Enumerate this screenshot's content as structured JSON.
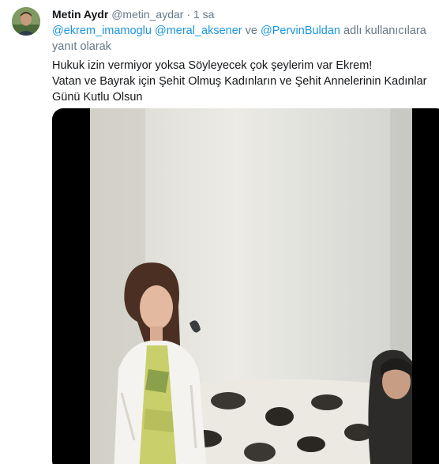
{
  "tweet": {
    "display_name": "Metin Aydr",
    "handle": "@metin_aydar",
    "separator": "·",
    "time": "1 sa",
    "reply": {
      "mentions": [
        "@ekrem_imamoglu",
        "@meral_aksener",
        "@PervinBuldan"
      ],
      "connector": "ve",
      "suffix": "adlı kullanıcılara yanıt olarak"
    },
    "text_lines": [
      "Hukuk izin vermiyor yoksa Söyleyecek çok şeylerim var Ekrem!",
      "Vatan ve Bayrak için  Şehit Olmuş Kadınların ve Şehit Annelerinin Kadınlar Günü Kutlu Olsun"
    ]
  },
  "colors": {
    "text": "#14171a",
    "secondary": "#657786",
    "link": "#1b95e0"
  },
  "icons": {
    "avatar": "profile-photo"
  }
}
